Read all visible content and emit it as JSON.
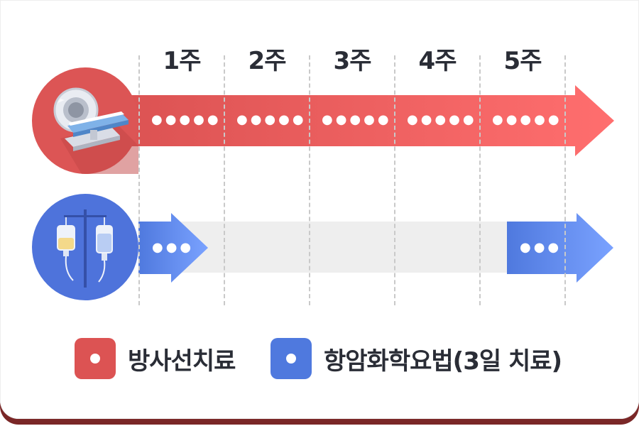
{
  "weeks": [
    "1주",
    "2주",
    "3주",
    "4주",
    "5주"
  ],
  "radiation": {
    "dots": [
      "●●●●●",
      "●●●●●",
      "●●●●●",
      "●●●●●",
      "●●●●●"
    ],
    "icon": "mri-scanner-icon",
    "color_start": "#dc5353",
    "color_end": "#ff6e6e"
  },
  "chemo": {
    "dots_start": "●●●",
    "dots_end": "●●●",
    "icon": "iv-drip-icon",
    "color_start": "#4f79de",
    "color_end": "#7aa2ff"
  },
  "legend": {
    "radiation_label": "방사선치료",
    "chemo_label": "항암화학요법(3일 치료)"
  }
}
